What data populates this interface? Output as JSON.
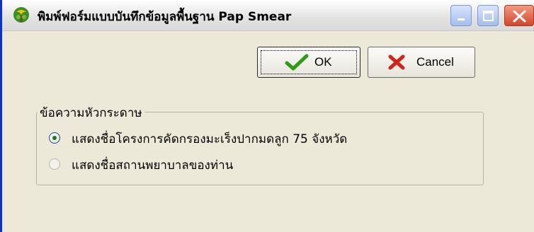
{
  "window": {
    "title": "พิมพ์ฟอร์มแบบบันทึกข้อมูลพื้นฐาน Pap Smear",
    "icon": "app-icon",
    "controls": [
      "minimize-icon",
      "maximize-icon",
      "close-icon"
    ]
  },
  "buttons": {
    "ok_label": "OK",
    "ok_icon": "checkmark-icon",
    "cancel_label": "Cancel",
    "cancel_icon": "x-icon"
  },
  "header_group": {
    "legend": "ข้อความหัวกระดาษ",
    "options": [
      {
        "label": "แสดงชื่อโครงการคัดกรองมะเร็งปากมดลูก 75 จังหวัด",
        "selected": true
      },
      {
        "label": "แสดงชื่อสถานพยาบาลของท่าน",
        "selected": false
      }
    ]
  },
  "colors": {
    "window_bg": "#ece9d8",
    "ok_check": "#2e9b1c",
    "cancel_x": "#d0231a",
    "close_button": "#d1472b"
  }
}
